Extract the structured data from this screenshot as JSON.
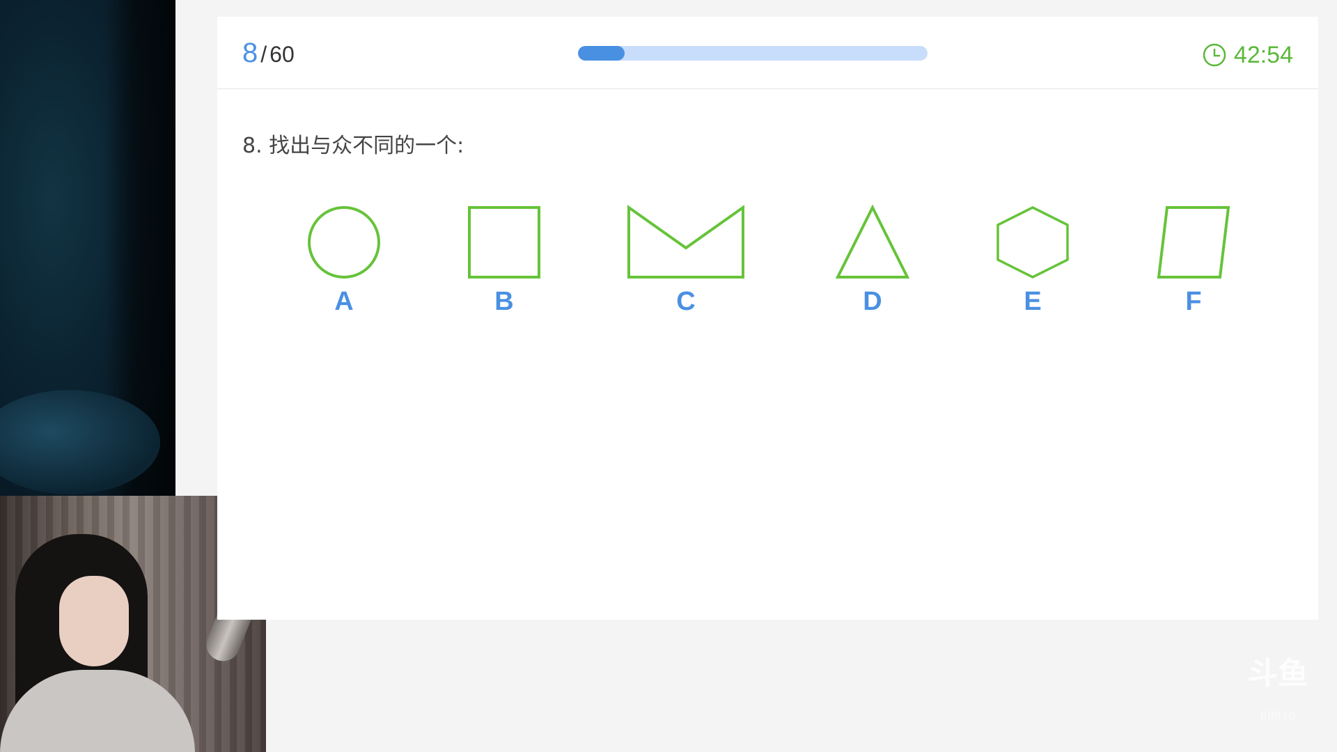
{
  "quiz": {
    "current": "8",
    "separator": "/",
    "total": "60",
    "progress_fraction": 0.133,
    "timer": "42:54",
    "question": "8. 找出与众不同的一个:"
  },
  "options": [
    {
      "label": "A",
      "shape": "circle-icon"
    },
    {
      "label": "B",
      "shape": "square-icon"
    },
    {
      "label": "C",
      "shape": "envelope-shape-icon"
    },
    {
      "label": "D",
      "shape": "triangle-icon"
    },
    {
      "label": "E",
      "shape": "hexagon-icon"
    },
    {
      "label": "F",
      "shape": "parallelogram-icon"
    }
  ],
  "colors": {
    "accent_blue": "#4a90e2",
    "shape_green": "#66c33a",
    "progress_track": "#c8ddfb",
    "timer_green": "#5bb83a"
  },
  "watermark": {
    "logo": "斗鱼",
    "room_id": "88810"
  }
}
